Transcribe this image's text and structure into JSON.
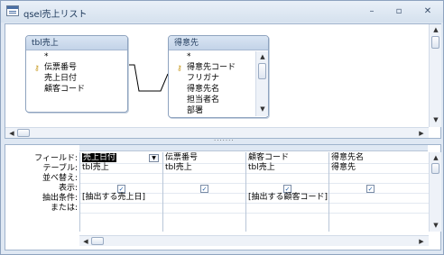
{
  "window": {
    "title": "qsel売上リスト",
    "min_glyph": "–",
    "max_glyph": "▫",
    "close_glyph": "✕"
  },
  "tables": [
    {
      "name": "tbl売上",
      "fields": [
        "*",
        "伝票番号",
        "売上日付",
        "顧客コード"
      ],
      "key_index": 1
    },
    {
      "name": "得意先",
      "fields": [
        "*",
        "得意先コード",
        "フリガナ",
        "得意先名",
        "担当者名",
        "部署"
      ],
      "key_index": 1
    }
  ],
  "scroll": {
    "up": "▲",
    "down": "▼",
    "left": "◀",
    "right": "▶"
  },
  "splitter_dots": "·······",
  "grid": {
    "row_labels": [
      "フィールド:",
      "テーブル:",
      "並べ替え:",
      "表示:",
      "抽出条件:",
      "または:"
    ],
    "dropdown_glyph": "▼",
    "check_glyph": "✓",
    "columns": [
      {
        "field": "売上日付",
        "table": "tbl売上",
        "show": true,
        "criteria": "[抽出する売上日]"
      },
      {
        "field": "伝票番号",
        "table": "tbl売上",
        "show": true,
        "criteria": ""
      },
      {
        "field": "顧客コード",
        "table": "tbl売上",
        "show": true,
        "criteria": "[抽出する顧客コード]"
      },
      {
        "field": "得意先名",
        "table": "得意先",
        "show": true,
        "criteria": ""
      }
    ]
  }
}
